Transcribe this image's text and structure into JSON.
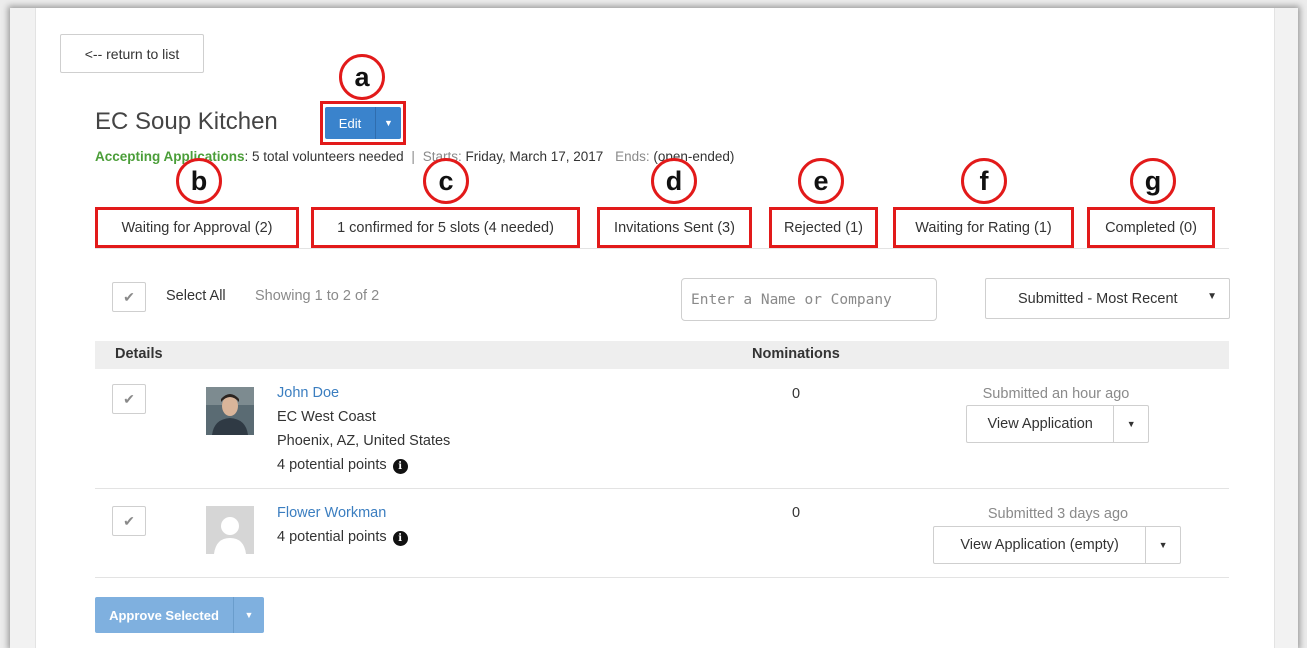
{
  "nav": {
    "return_label": "<-- return to list"
  },
  "opportunity": {
    "title": "EC Soup Kitchen",
    "edit_label": "Edit",
    "status_label": "Accepting Applications",
    "status_detail": ": 5 total volunteers needed",
    "separator": "|",
    "starts_label": "Starts:",
    "starts_value": "Friday, March 17, 2017",
    "ends_label": "Ends:",
    "ends_value": "(open-ended)"
  },
  "markers": [
    "a",
    "b",
    "c",
    "d",
    "e",
    "f",
    "g"
  ],
  "tabs": [
    {
      "label": "Waiting for Approval (2)"
    },
    {
      "label": "1 confirmed for 5 slots (4 needed)"
    },
    {
      "label": "Invitations Sent (3)"
    },
    {
      "label": "Rejected (1)"
    },
    {
      "label": "Waiting for Rating (1)"
    },
    {
      "label": "Completed (0)"
    }
  ],
  "toolbar": {
    "select_all": "Select All",
    "showing": "Showing 1 to 2 of 2",
    "search_placeholder": "Enter a Name or Company",
    "sort_value": "Submitted - Most Recent"
  },
  "table": {
    "columns": [
      "Details",
      "Nominations"
    ],
    "rows": [
      {
        "name": "John Doe",
        "organization": "EC West Coast",
        "location": "Phoenix, AZ, United States",
        "points": "4 potential points",
        "nominations": "0",
        "submitted": "Submitted an hour ago",
        "action": "View Application"
      },
      {
        "name": "Flower Workman",
        "points": "4 potential points",
        "nominations": "0",
        "submitted": "Submitted 3 days ago",
        "action": "View Application (empty)"
      }
    ]
  },
  "footer": {
    "approve_label": "Approve Selected"
  },
  "icons": {
    "check": "checkmark-icon",
    "caret": "caret-down-icon",
    "info": "info-icon"
  },
  "colors": {
    "accent": "#3a83cc",
    "status_green": "#4b9e39",
    "annotation_red": "#e21a1a",
    "link": "#3b7ec0"
  }
}
